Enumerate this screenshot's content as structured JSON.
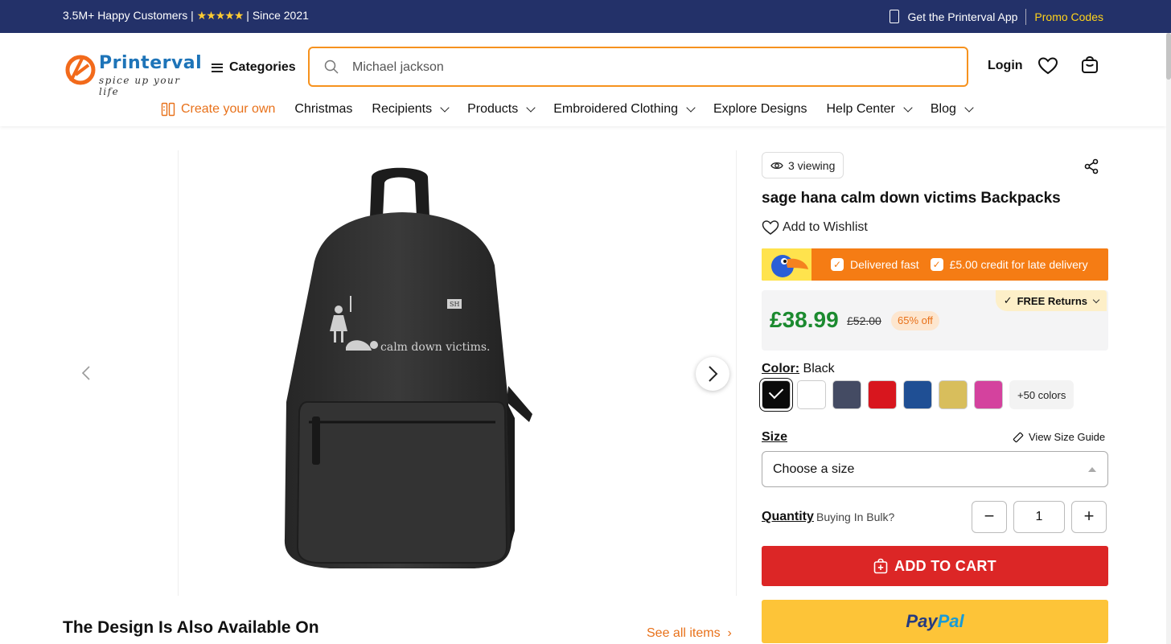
{
  "topbar": {
    "customers": "3.5M+ Happy Customers | ",
    "stars": "★★★★★",
    "since": " | Since 2021",
    "app": "Get the Printerval App",
    "promo": "Promo Codes"
  },
  "header": {
    "logo_name": "Printerval",
    "logo_tagline": "spice up your life",
    "categories": "Categories",
    "search_placeholder": "Michael jackson",
    "login": "Login"
  },
  "nav": {
    "items": [
      "Create your own",
      "Christmas",
      "Recipients",
      "Products",
      "Embroidered Clothing",
      "Explore Designs",
      "Help Center",
      "Blog"
    ]
  },
  "product": {
    "viewing": "3 viewing",
    "title": "sage hana calm down victims Backpacks",
    "wishlist": "Add to Wishlist",
    "delivery_fast": "Delivered fast",
    "delivery_credit": "£5.00 credit for late delivery",
    "free_returns": "FREE Returns",
    "price": "£38.99",
    "old_price": "£52.00",
    "discount": "65% off",
    "color_label": "Color:",
    "color_value": " Black",
    "more_colors": "+50 colors",
    "size_label": "Size",
    "size_guide": "View Size Guide",
    "size_placeholder": "Choose a size",
    "quantity_label": "Quantity",
    "bulk": "Buying In Bulk?",
    "quantity": "1",
    "minus": "−",
    "plus": "+",
    "add_to_cart": "ADD TO CART",
    "paypal_1": "Pay",
    "paypal_2": "Pal",
    "print_text": "calm down victims.",
    "print_logo": "SH"
  },
  "swatch_colors": [
    "#0a0a0a",
    "#ffffff",
    "#444b63",
    "#d8161e",
    "#1f4f94",
    "#d8be5c",
    "#d4429e"
  ],
  "section": {
    "design_title": "The Design Is Also Available On",
    "see_all": "See all items"
  },
  "colors": {
    "topbar": "#233169",
    "accent": "#f6921e",
    "price": "#1b8a2f",
    "cart": "#dc2626",
    "paypal": "#fdc438"
  }
}
